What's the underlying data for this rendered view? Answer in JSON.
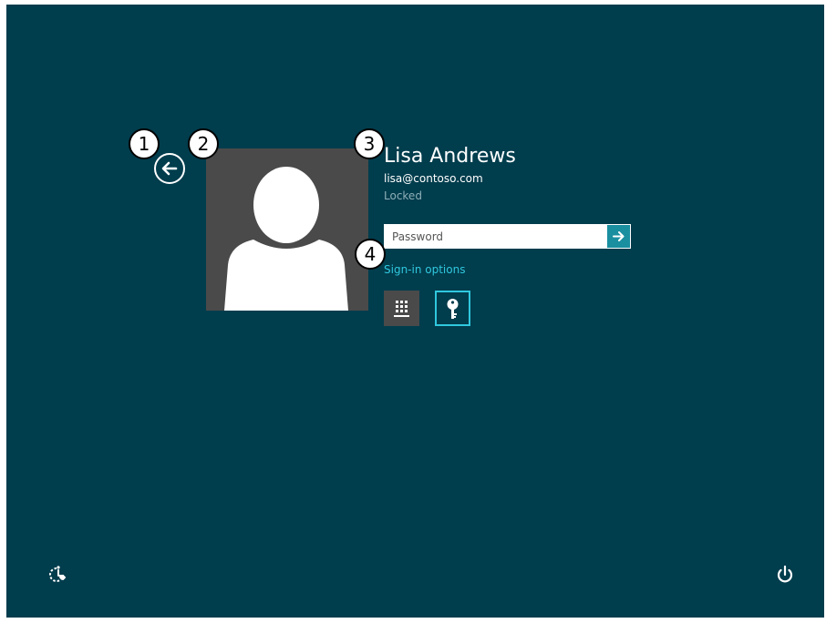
{
  "user": {
    "name": "Lisa Andrews",
    "email": "lisa@contoso.com",
    "status": "Locked"
  },
  "password": {
    "placeholder": "Password"
  },
  "sign_in_options_label": "Sign-in options",
  "callouts": [
    "1",
    "2",
    "3",
    "4"
  ],
  "icons": {
    "back": "back-arrow-icon",
    "submit": "arrow-right-icon",
    "pin": "keypad-icon",
    "password": "key-icon",
    "ease_of_access": "ease-of-access-icon",
    "power": "power-icon"
  },
  "colors": {
    "background": "#003d4d",
    "accent": "#30c8de",
    "tile": "#4a4a4a",
    "submit": "#1a8fa0"
  }
}
